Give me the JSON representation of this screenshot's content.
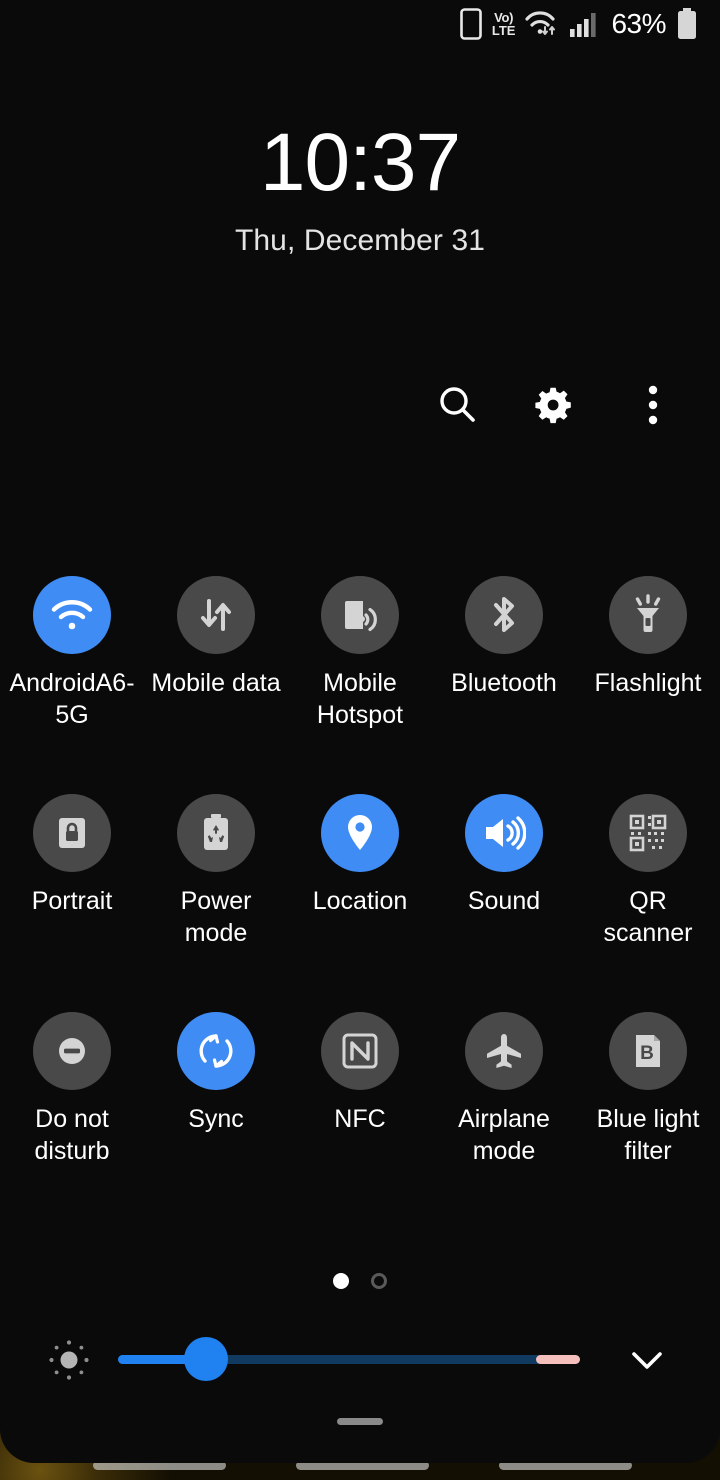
{
  "status_bar": {
    "items": [
      {
        "icon": "phone-portrait-icon",
        "label": ""
      },
      {
        "icon": "volte-icon",
        "label_top": "Vo)",
        "label_bottom": "LTE"
      },
      {
        "icon": "wifi-data-transfer-icon",
        "label": ""
      },
      {
        "icon": "cellular-signal-icon",
        "label": ""
      }
    ],
    "battery_percent": "63%",
    "battery_icon": "battery-icon"
  },
  "clock": {
    "time": "10:37",
    "date": "Thu, December 31"
  },
  "header_actions": [
    {
      "name": "search-icon",
      "label": "Search"
    },
    {
      "name": "gear-icon",
      "label": "Settings"
    },
    {
      "name": "overflow-menu-icon",
      "label": "More options"
    }
  ],
  "tiles": [
    {
      "label": "AndroidA6-5G",
      "icon": "wifi-icon",
      "active": true
    },
    {
      "label": "Mobile data",
      "icon": "data-transfer-icon",
      "active": false
    },
    {
      "label": "Mobile Hotspot",
      "icon": "hotspot-icon",
      "active": false
    },
    {
      "label": "Bluetooth",
      "icon": "bluetooth-icon",
      "active": false
    },
    {
      "label": "Flashlight",
      "icon": "flashlight-icon",
      "active": false
    },
    {
      "label": "Portrait",
      "icon": "rotation-lock-icon",
      "active": false
    },
    {
      "label": "Power mode",
      "icon": "battery-saver-icon",
      "active": false
    },
    {
      "label": "Location",
      "icon": "location-pin-icon",
      "active": true
    },
    {
      "label": "Sound",
      "icon": "volume-icon",
      "active": true
    },
    {
      "label": "QR scanner",
      "icon": "qr-code-icon",
      "active": false
    },
    {
      "label": "Do not disturb",
      "icon": "do-not-disturb-icon",
      "active": false
    },
    {
      "label": "Sync",
      "icon": "sync-icon",
      "active": true
    },
    {
      "label": "NFC",
      "icon": "nfc-icon",
      "active": false
    },
    {
      "label": "Airplane mode",
      "icon": "airplane-icon",
      "active": false
    },
    {
      "label": "Blue light filter",
      "icon": "blue-light-filter-icon",
      "active": false
    }
  ],
  "page_indicator": {
    "total_pages": 2,
    "current_page": 1
  },
  "brightness": {
    "icon": "brightness-sun-icon",
    "value_percent": 19,
    "warm_segment_percent": 9.5,
    "expand_icon": "chevron-down-icon"
  },
  "colors": {
    "accent_blue": "#3f8cf5",
    "slider_blue": "#1f82f0",
    "slider_track": "#113a60",
    "slider_warm": "#f5bfbc",
    "tile_inactive": "#494949",
    "panel_background": "#0a0a0a",
    "icon_light": "#d4d4d4"
  }
}
